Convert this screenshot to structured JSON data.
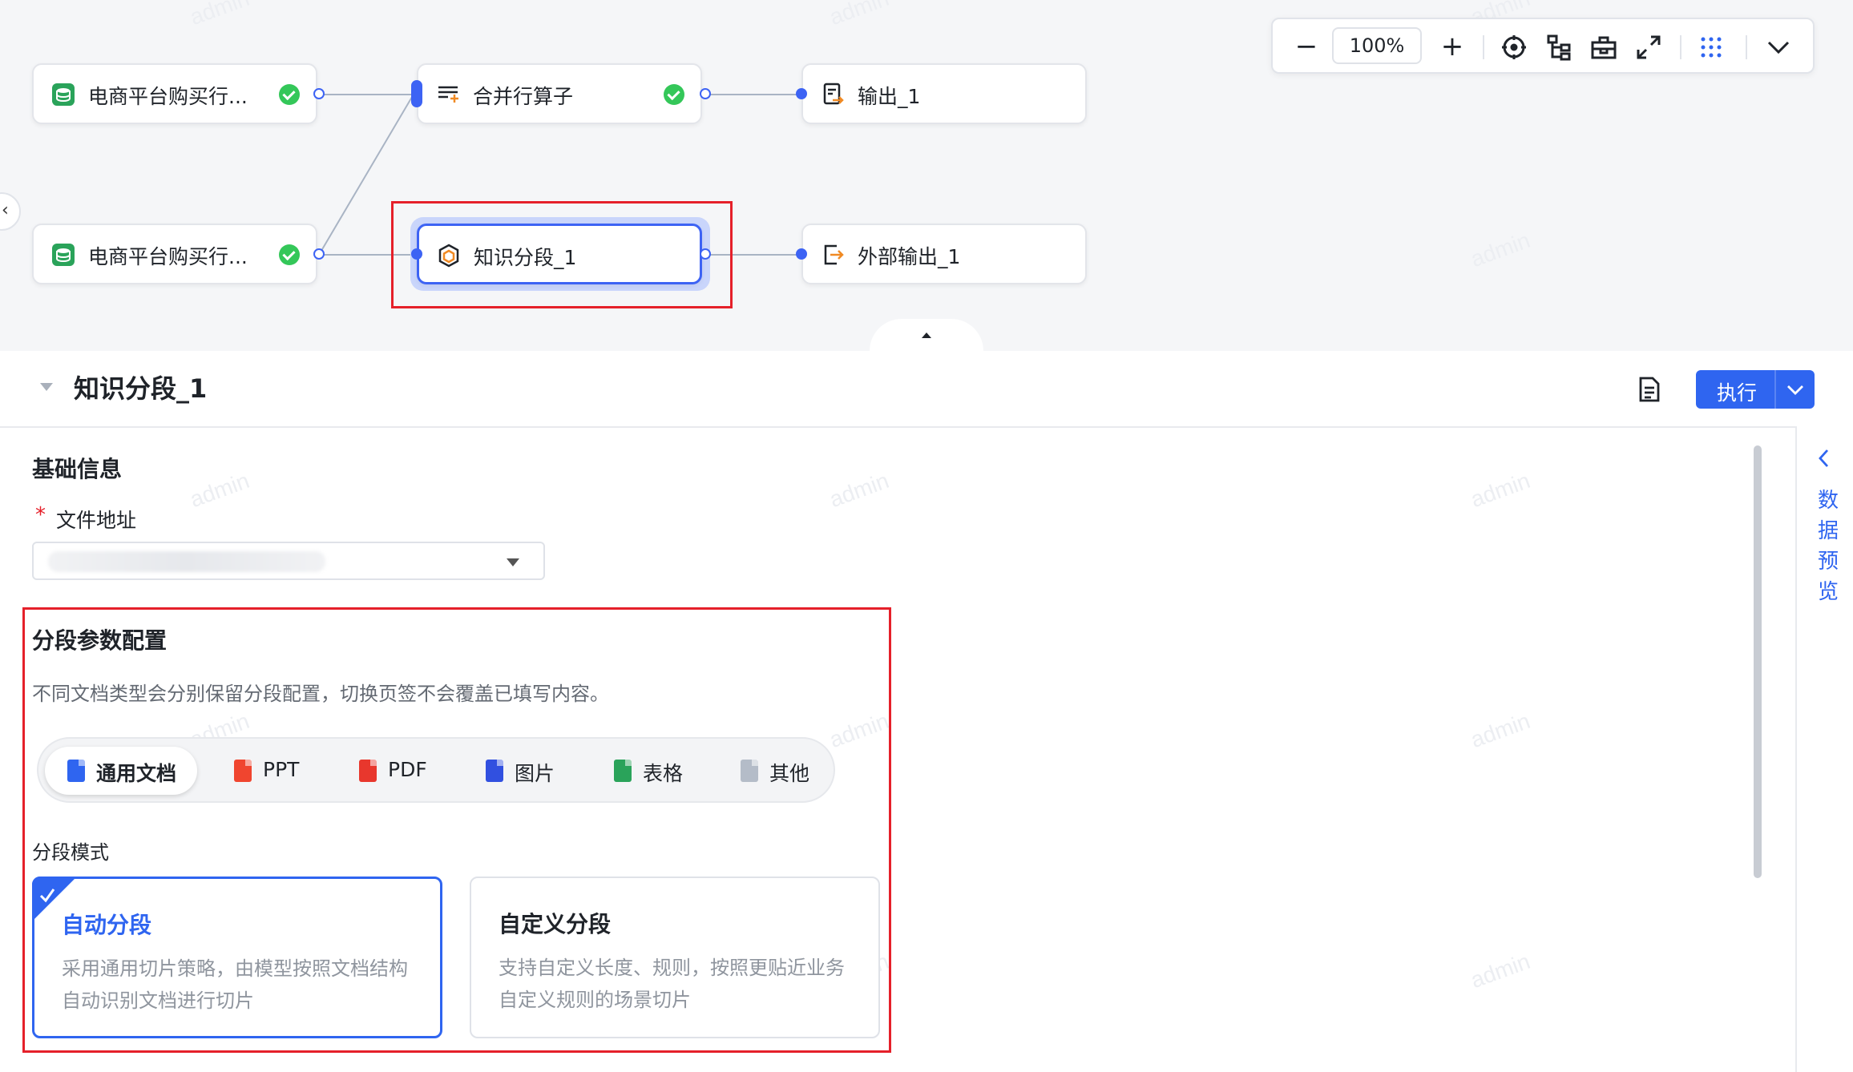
{
  "watermark": "admin",
  "canvas": {
    "nodes": [
      {
        "label": "电商平台购买行...",
        "status": "success"
      },
      {
        "label": "合并行算子",
        "status": "success"
      },
      {
        "label": "输出_1"
      },
      {
        "label": "电商平台购买行...",
        "status": "success"
      },
      {
        "label": "知识分段_1",
        "selected": true
      },
      {
        "label": "外部输出_1"
      }
    ],
    "zoom": {
      "value": "100%"
    }
  },
  "panel": {
    "title": "知识分段_1",
    "run_label": "执行",
    "side_label": [
      "数",
      "据",
      "预",
      "览"
    ],
    "basic": {
      "title": "基础信息",
      "required_mark": "*",
      "file_label": "文件地址"
    },
    "segment": {
      "title": "分段参数配置",
      "hint": "不同文档类型会分别保留分段配置，切换页签不会覆盖已填写内容。",
      "tabs": [
        {
          "label": "通用文档",
          "active": true,
          "color": "#2f65f0"
        },
        {
          "label": "PPT",
          "color": "#f0452f"
        },
        {
          "label": "PDF",
          "color": "#e8372d"
        },
        {
          "label": "图片",
          "color": "#3150e0"
        },
        {
          "label": "表格",
          "color": "#2aa35a"
        },
        {
          "label": "其他",
          "color": "#b4bcc8"
        }
      ],
      "mode_label": "分段模式",
      "modes": [
        {
          "title": "自动分段",
          "desc": "采用通用切片策略，由模型按照文档结构自动识别文档进行切片",
          "selected": true
        },
        {
          "title": "自定义分段",
          "desc": "支持自定义长度、规则，按照更贴近业务自定义规则的场景切片",
          "selected": false
        }
      ]
    }
  },
  "colors": {
    "accent": "#2f65f0",
    "success": "#34c759",
    "highlight": "#e5202a"
  }
}
